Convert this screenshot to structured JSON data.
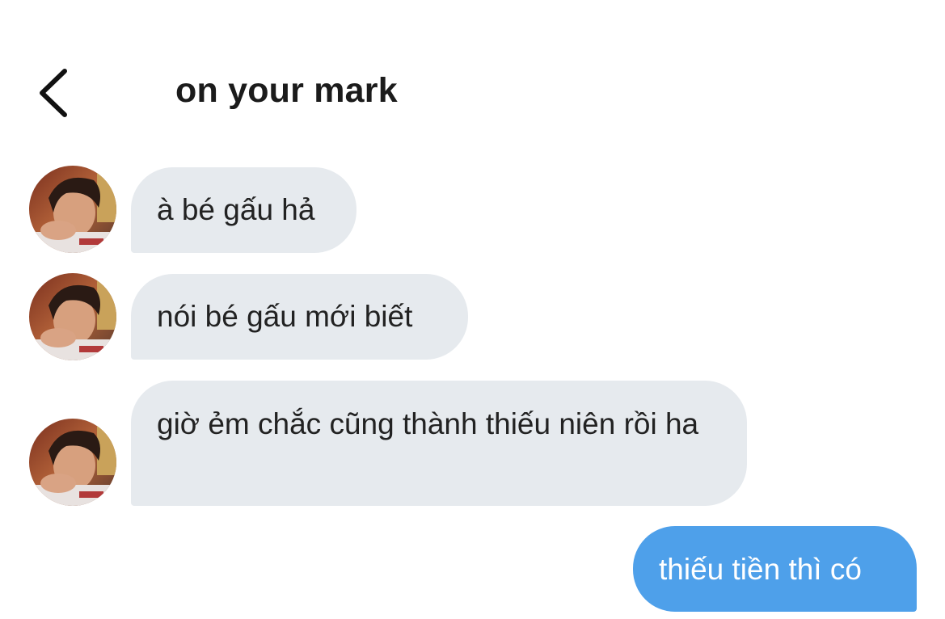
{
  "header": {
    "title": "on your mark",
    "back_icon": "chevron-left-icon"
  },
  "colors": {
    "received_bubble": "#e6eaee",
    "sent_bubble": "#4ea0ea",
    "text": "#222222"
  },
  "messages": [
    {
      "direction": "received",
      "text": "à bé gấu hả",
      "avatar": "user-avatar"
    },
    {
      "direction": "received",
      "text": "nói bé gấu mới biết",
      "avatar": "user-avatar"
    },
    {
      "direction": "received",
      "text": "giờ ẻm chắc cũng thành thiếu niên rồi ha",
      "avatar": "user-avatar"
    },
    {
      "direction": "sent",
      "text": "thiếu tiền thì có"
    }
  ]
}
